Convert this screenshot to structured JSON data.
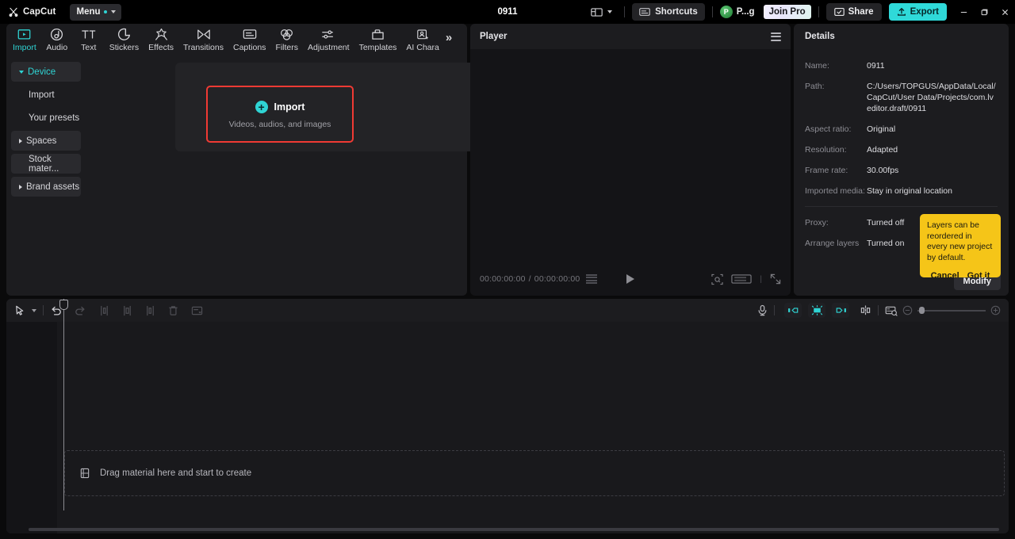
{
  "titlebar": {
    "app_name": "CapCut",
    "menu_label": "Menu",
    "project_title": "0911",
    "shortcuts_label": "Shortcuts",
    "account_initial": "P",
    "account_name": "P...g",
    "join_pro_label": "Join Pro",
    "share_label": "Share",
    "export_label": "Export",
    "minimize_label": "—",
    "maximize_label": "❐",
    "close_label": "✕",
    "accent_color": "#2fd9d9"
  },
  "nav": {
    "tabs": [
      {
        "label": "Import",
        "icon": "import-icon",
        "active": true
      },
      {
        "label": "Audio",
        "icon": "audio-icon",
        "active": false
      },
      {
        "label": "Text",
        "icon": "text-icon",
        "active": false
      },
      {
        "label": "Stickers",
        "icon": "stickers-icon",
        "active": false
      },
      {
        "label": "Effects",
        "icon": "effects-icon",
        "active": false
      },
      {
        "label": "Transitions",
        "icon": "transitions-icon",
        "active": false
      },
      {
        "label": "Captions",
        "icon": "captions-icon",
        "active": false
      },
      {
        "label": "Filters",
        "icon": "filters-icon",
        "active": false
      },
      {
        "label": "Adjustment",
        "icon": "adjustment-icon",
        "active": false
      },
      {
        "label": "Templates",
        "icon": "templates-icon",
        "active": false
      },
      {
        "label": "AI Chara",
        "icon": "ai-character-icon",
        "active": false
      }
    ],
    "more_label": "»"
  },
  "sidebar": {
    "items": [
      {
        "label": "Device",
        "type": "group-open",
        "selected": true
      },
      {
        "label": "Import",
        "type": "sub",
        "selected": false
      },
      {
        "label": "Your presets",
        "type": "sub",
        "selected": false
      },
      {
        "label": "Spaces",
        "type": "group-closed",
        "selected": false
      },
      {
        "label": "Stock mater...",
        "type": "plain",
        "selected": false
      },
      {
        "label": "Brand assets",
        "type": "group-closed",
        "selected": false
      }
    ]
  },
  "import_card": {
    "title": "Import",
    "subtitle": "Videos, audios, and images",
    "plus_glyph": "+",
    "highlight_color": "#f03a34"
  },
  "player": {
    "title": "Player",
    "current_time": "00:00:00:00",
    "total_time": "00:00:00:00",
    "time_separator": "/"
  },
  "details": {
    "title": "Details",
    "rows": [
      {
        "label": "Name:",
        "value": "0911"
      },
      {
        "label": "Path:",
        "value": "C:/Users/TOPGUS/AppData/Local/CapCut/User Data/Projects/com.lveditor.draft/0911"
      },
      {
        "label": "Aspect ratio:",
        "value": "Original"
      },
      {
        "label": "Resolution:",
        "value": "Adapted"
      },
      {
        "label": "Frame rate:",
        "value": "30.00fps"
      },
      {
        "label": "Imported media:",
        "value": "Stay in original location"
      }
    ],
    "rows2": [
      {
        "label": "Proxy:",
        "value": "Turned off"
      },
      {
        "label": "Arrange layers",
        "value": "Turned on"
      }
    ],
    "modify_label": "Modify"
  },
  "tooltip": {
    "text": "Layers can be reordered in every new project by default.",
    "cancel_label": "Cancel",
    "confirm_label": "Got it",
    "background_color": "#f5c518"
  },
  "timeline": {
    "dropzone_text": "Drag material here and start to create",
    "tools_left": [
      {
        "name": "select-tool",
        "enabled": true
      },
      {
        "name": "select-dropdown",
        "enabled": true
      },
      {
        "name": "undo-button",
        "enabled": true
      },
      {
        "name": "redo-button",
        "enabled": false
      },
      {
        "name": "split-left-button",
        "enabled": false
      },
      {
        "name": "split-button",
        "enabled": false
      },
      {
        "name": "split-right-button",
        "enabled": false
      },
      {
        "name": "delete-button",
        "enabled": false
      },
      {
        "name": "crop-button",
        "enabled": false
      }
    ],
    "tools_right": [
      {
        "name": "record-voiceover-button",
        "active": false
      },
      {
        "name": "auto-cut-start-button",
        "active": true
      },
      {
        "name": "auto-cut-middle-button",
        "active": true
      },
      {
        "name": "auto-cut-end-button",
        "active": true
      },
      {
        "name": "split-clip-button",
        "active": false
      },
      {
        "name": "snapshot-button",
        "active": false
      },
      {
        "name": "zoom-out-button",
        "active": false
      },
      {
        "name": "zoom-in-button",
        "active": false
      }
    ]
  }
}
